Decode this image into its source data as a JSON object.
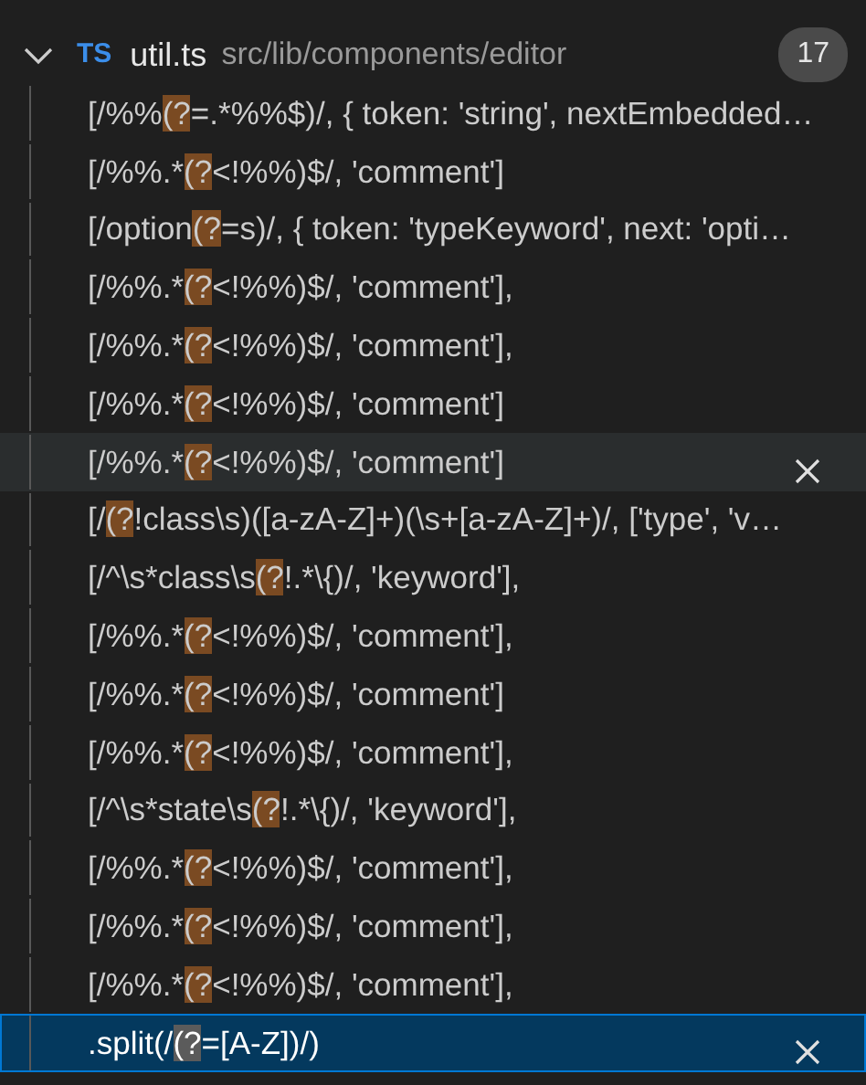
{
  "file_group": {
    "expanded": true,
    "type_icon": "TS",
    "file_name": "util.ts",
    "path": "src/lib/components/editor",
    "match_count": "17",
    "matches": [
      {
        "before": "[/%%",
        "match": "(?",
        "after": "=.*%%$)/, { token: 'string', nextEmbedded…",
        "selected": false,
        "hovered": false
      },
      {
        "before": "[/%%.*",
        "match": "(?",
        "after": "<!%%)$/, 'comment']",
        "selected": false,
        "hovered": false
      },
      {
        "before": "[/option",
        "match": "(?",
        "after": "=s)/, { token: 'typeKeyword', next: 'opti…",
        "selected": false,
        "hovered": false
      },
      {
        "before": "[/%%.*",
        "match": "(?",
        "after": "<!%%)$/, 'comment'],",
        "selected": false,
        "hovered": false
      },
      {
        "before": "[/%%.*",
        "match": "(?",
        "after": "<!%%)$/, 'comment'],",
        "selected": false,
        "hovered": false
      },
      {
        "before": "[/%%.*",
        "match": "(?",
        "after": "<!%%)$/, 'comment']",
        "selected": false,
        "hovered": false
      },
      {
        "before": "[/%%.*",
        "match": "(?",
        "after": "<!%%)$/, 'comment']",
        "selected": false,
        "hovered": true
      },
      {
        "before": "[/",
        "match": "(?",
        "after": "!class\\s)([a-zA-Z]+)(\\s+[a-zA-Z]+)/, ['type', 'v…",
        "selected": false,
        "hovered": false
      },
      {
        "before": "[/^\\s*class\\s",
        "match": "(?",
        "after": "!.*\\{)/, 'keyword'],",
        "selected": false,
        "hovered": false
      },
      {
        "before": "[/%%.*",
        "match": "(?",
        "after": "<!%%)$/, 'comment'],",
        "selected": false,
        "hovered": false
      },
      {
        "before": "[/%%.*",
        "match": "(?",
        "after": "<!%%)$/, 'comment']",
        "selected": false,
        "hovered": false
      },
      {
        "before": "[/%%.*",
        "match": "(?",
        "after": "<!%%)$/, 'comment'],",
        "selected": false,
        "hovered": false
      },
      {
        "before": "[/^\\s*state\\s",
        "match": "(?",
        "after": "!.*\\{)/, 'keyword'],",
        "selected": false,
        "hovered": false
      },
      {
        "before": "[/%%.*",
        "match": "(?",
        "after": "<!%%)$/, 'comment'],",
        "selected": false,
        "hovered": false
      },
      {
        "before": "[/%%.*",
        "match": "(?",
        "after": "<!%%)$/, 'comment'],",
        "selected": false,
        "hovered": false
      },
      {
        "before": "[/%%.*",
        "match": "(?",
        "after": "<!%%)$/, 'comment'],",
        "selected": false,
        "hovered": false
      },
      {
        "before": ".split(/",
        "match": "(?",
        "after": "=[A-Z])/)",
        "selected": true,
        "hovered": false
      }
    ]
  }
}
